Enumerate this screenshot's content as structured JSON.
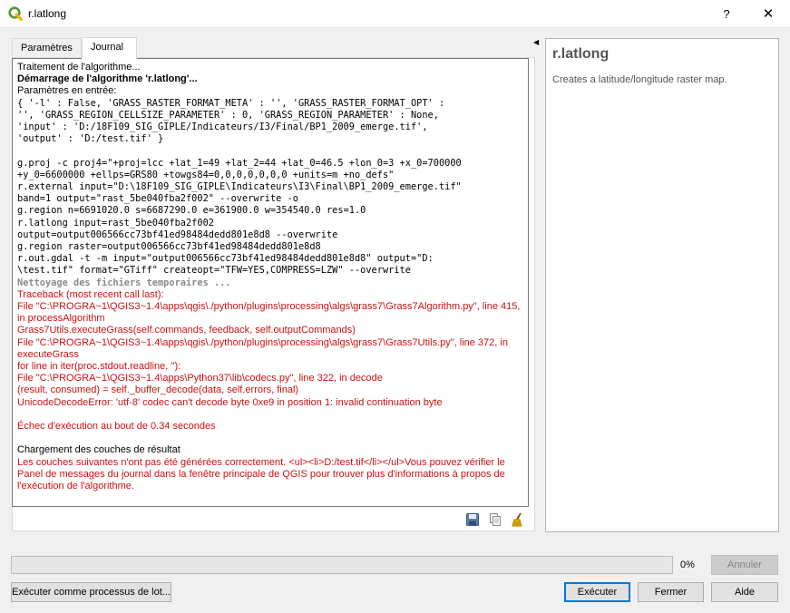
{
  "window": {
    "title": "r.latlong",
    "help_glyph": "?",
    "close_glyph": "✕"
  },
  "tabs": [
    {
      "label": "Paramètres"
    },
    {
      "label": "Journal"
    }
  ],
  "log": [
    {
      "style": "",
      "text": "Traitement de l'algorithme..."
    },
    {
      "style": "b",
      "text": "Démarrage de l'algorithme 'r.latlong'..."
    },
    {
      "style": "",
      "text": "Paramètres en entrée:"
    },
    {
      "style": "m",
      "text": "{ '-l' : False, 'GRASS_RASTER_FORMAT_META' : '', 'GRASS_RASTER_FORMAT_OPT' :"
    },
    {
      "style": "m",
      "text": "'', 'GRASS_REGION_CELLSIZE_PARAMETER' : 0, 'GRASS_REGION_PARAMETER' : None,"
    },
    {
      "style": "m",
      "text": "'input' : 'D:/18F109_SIG_GIPLE/Indicateurs/I3/Final/BP1_2009_emerge.tif',"
    },
    {
      "style": "m",
      "text": "'output' : 'D:/test.tif' }"
    },
    {
      "style": "sp",
      "text": ""
    },
    {
      "style": "m",
      "text": "g.proj -c proj4=\"+proj=lcc +lat_1=49 +lat_2=44 +lat_0=46.5 +lon_0=3 +x_0=700000"
    },
    {
      "style": "m",
      "text": "+y_0=6600000 +ellps=GRS80 +towgs84=0,0,0,0,0,0,0 +units=m +no_defs\""
    },
    {
      "style": "m",
      "text": "r.external input=\"D:\\18F109_SIG_GIPLE\\Indicateurs\\I3\\Final\\BP1_2009_emerge.tif\""
    },
    {
      "style": "m",
      "text": "band=1 output=\"rast_5be040fba2f002\" --overwrite -o"
    },
    {
      "style": "m",
      "text": "g.region n=6691020.0 s=6687290.0 e=361900.0 w=354540.0 res=1.0"
    },
    {
      "style": "m",
      "text": "r.latlong input=rast_5be040fba2f002"
    },
    {
      "style": "m",
      "text": "output=output006566cc73bf41ed98484dedd801e8d8 --overwrite"
    },
    {
      "style": "m",
      "text": "g.region raster=output006566cc73bf41ed98484dedd801e8d8"
    },
    {
      "style": "m",
      "text": "r.out.gdal -t -m input=\"output006566cc73bf41ed98484dedd801e8d8\" output=\"D:"
    },
    {
      "style": "m",
      "text": "\\test.tif\" format=\"GTiff\" createopt=\"TFW=YES,COMPRESS=LZW\" --overwrite"
    },
    {
      "style": "m g",
      "text": "Nettoyage des fichiers temporaires ..."
    },
    {
      "style": "r",
      "text": "Traceback (most recent call last):"
    },
    {
      "style": "r",
      "text": "File \"C:\\PROGRA~1\\QGIS3~1.4\\apps\\qgis\\./python/plugins\\processing\\algs\\grass7\\Grass7Algorithm.py\", line 415,"
    },
    {
      "style": "r",
      "text": "in processAlgorithm"
    },
    {
      "style": "r",
      "text": "Grass7Utils.executeGrass(self.commands, feedback, self.outputCommands)"
    },
    {
      "style": "r",
      "text": "File \"C:\\PROGRA~1\\QGIS3~1.4\\apps\\qgis\\./python/plugins\\processing\\algs\\grass7\\Grass7Utils.py\", line 372, in"
    },
    {
      "style": "r",
      "text": "executeGrass"
    },
    {
      "style": "r",
      "text": "for line in iter(proc.stdout.readline, ''):"
    },
    {
      "style": "r",
      "text": "File \"C:\\PROGRA~1\\QGIS3~1.4\\apps\\Python37\\lib\\codecs.py\", line 322, in decode"
    },
    {
      "style": "r",
      "text": "(result, consumed) = self._buffer_decode(data, self.errors, final)"
    },
    {
      "style": "r",
      "text": "UnicodeDecodeError: 'utf-8' codec can't decode byte 0xe9 in position 1: invalid continuation byte"
    },
    {
      "style": "sp",
      "text": ""
    },
    {
      "style": "r",
      "text": "Échec d'exécution au bout de 0.34 secondes"
    },
    {
      "style": "sp",
      "text": ""
    },
    {
      "style": "",
      "text": "Chargement des couches de résultat"
    },
    {
      "style": "r",
      "text": "Les couches suivantes n'ont pas été générées correctement. <ul><li>D:/test.tif</li></ul>Vous pouvez vérifier le"
    },
    {
      "style": "r",
      "text": "Panel de messages du journal dans la fenêtre principale de QGIS pour trouver plus d'informations à propos de"
    },
    {
      "style": "r",
      "text": "l'exécution de l'algorithme."
    }
  ],
  "log_tools": [
    {
      "name": "save-log-icon"
    },
    {
      "name": "copy-log-icon"
    },
    {
      "name": "clear-log-icon"
    }
  ],
  "help": {
    "title": "r.latlong",
    "description": "Creates a latitude/longitude raster map."
  },
  "progress": {
    "value_percent": 0,
    "label": "0%"
  },
  "buttons": {
    "cancel": "Annuler",
    "batch": "Exécuter comme processus de lot...",
    "run": "Exécuter",
    "close": "Fermer",
    "help": "Aide"
  },
  "colors": {
    "error_text": "#cc1010",
    "muted_text": "#8a8a8a",
    "accent_border": "#0078d7",
    "qgis_green": "#589632",
    "qgis_yellow": "#f0b400"
  }
}
